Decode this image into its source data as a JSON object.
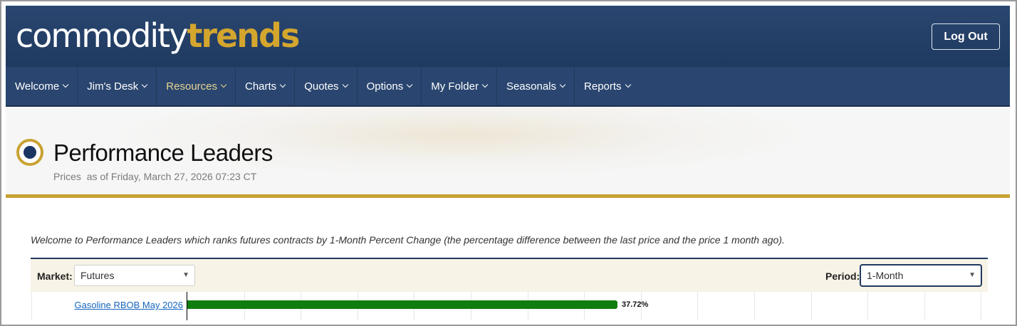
{
  "header": {
    "logo_part1": "commodity",
    "logo_part2": "trends",
    "logout_label": "Log Out"
  },
  "nav": {
    "items": [
      {
        "label": "Welcome"
      },
      {
        "label": "Jim's Desk"
      },
      {
        "label": "Resources"
      },
      {
        "label": "Charts"
      },
      {
        "label": "Quotes"
      },
      {
        "label": "Options"
      },
      {
        "label": "My Folder"
      },
      {
        "label": "Seasonals"
      },
      {
        "label": "Reports"
      }
    ]
  },
  "page": {
    "title": "Performance Leaders",
    "subtitle_prefix": "Prices",
    "subtitle_date": "as of Friday, March 27, 2026 07:23 CT"
  },
  "intro": "Welcome to Performance Leaders which ranks futures contracts by 1-Month Percent Change (the percentage difference between the last price and the price 1 month ago).",
  "filters": {
    "market_label": "Market:",
    "market_value": "Futures",
    "period_label": "Period:",
    "period_value": "1-Month"
  },
  "chart_data": {
    "type": "bar",
    "orientation": "horizontal",
    "categories": [
      "Gasoline RBOB May 2026"
    ],
    "values": [
      37.72
    ],
    "value_labels": [
      "37.72%"
    ],
    "bar_color": "#0f7d0f",
    "xlim": [
      0,
      70
    ]
  },
  "colors": {
    "brand_navy": "#1f3a5f",
    "brand_gold": "#c9a233",
    "active_nav": "#e7d48f"
  }
}
